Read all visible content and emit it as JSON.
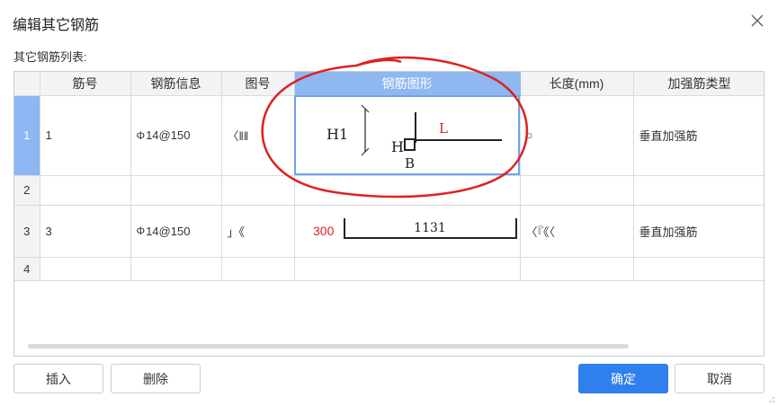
{
  "dialog": {
    "title": "编辑其它钢筋"
  },
  "list_label": "其它钢筋列表:",
  "columns": [
    "",
    "筋号",
    "钢筋信息",
    "图号",
    "钢筋图形",
    "长度(mm)",
    "加强筋类型"
  ],
  "rows": [
    {
      "index": "1",
      "bar_no": "1",
      "info_symbol": "Φ",
      "info_value": "14@150",
      "figure_no": "〈‖‖",
      "length": "○",
      "type": "垂直加强筋",
      "shape": {
        "h1": "H1",
        "h": "H",
        "b": "B",
        "l": "L"
      }
    },
    {
      "index": "2",
      "bar_no": "",
      "info_symbol": "",
      "info_value": "",
      "figure_no": "",
      "length": "",
      "type": ""
    },
    {
      "index": "3",
      "bar_no": "3",
      "info_symbol": "Φ",
      "info_value": "14@150",
      "figure_no": "」《",
      "length": "〈『《〈",
      "type": "垂直加强筋",
      "shape": {
        "left_value": "300",
        "mid_value": "1131"
      }
    },
    {
      "index": "4",
      "bar_no": "",
      "info_symbol": "",
      "info_value": "",
      "figure_no": "",
      "length": "",
      "type": ""
    }
  ],
  "buttons": {
    "insert": "插入",
    "delete": "删除",
    "ok": "确定",
    "cancel": "取消"
  },
  "colors": {
    "accent": "#2f80ed",
    "selected_header": "#8fb7f0",
    "annotation": "#e02020"
  }
}
